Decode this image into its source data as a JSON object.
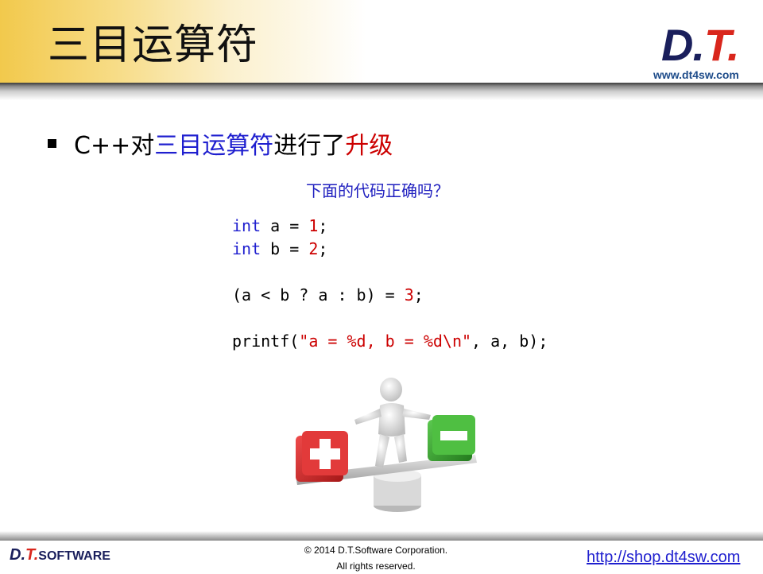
{
  "header": {
    "title": "三目运算符",
    "logo_main": "D.",
    "logo_t": "T.",
    "logo_url": "www.dt4sw.com"
  },
  "bullet": {
    "prefix": "C++对",
    "highlight_blue": "三目运算符",
    "middle": "进行了",
    "highlight_red": "升级"
  },
  "question": "下面的代码正确吗？",
  "code": {
    "line1": {
      "kw": "int",
      "rest": " a = ",
      "num": "1",
      "end": ";"
    },
    "line2": {
      "kw": "int",
      "rest": " b = ",
      "num": "2",
      "end": ";"
    },
    "line3": {
      "rest": "(a < b ? a : b) = ",
      "num": "3",
      "end": ";"
    },
    "line4": {
      "pre": "printf(",
      "str": "\"a = %d, b = %d\\n\"",
      "end": ", a, b);"
    }
  },
  "figure": {
    "plus_icon": "plus-cube-icon",
    "minus_icon": "minus-cube-icon",
    "person_icon": "balancing-person-icon",
    "plus_color": "#d62b2b",
    "minus_color": "#3aa832"
  },
  "footer": {
    "logo_main": "D.",
    "logo_t": "T.",
    "logo_software": "SOFTWARE",
    "copyright_line1": "© 2014 D.T.Software Corporation.",
    "copyright_line2": "All rights reserved.",
    "url": "http://shop.dt4sw.com"
  }
}
